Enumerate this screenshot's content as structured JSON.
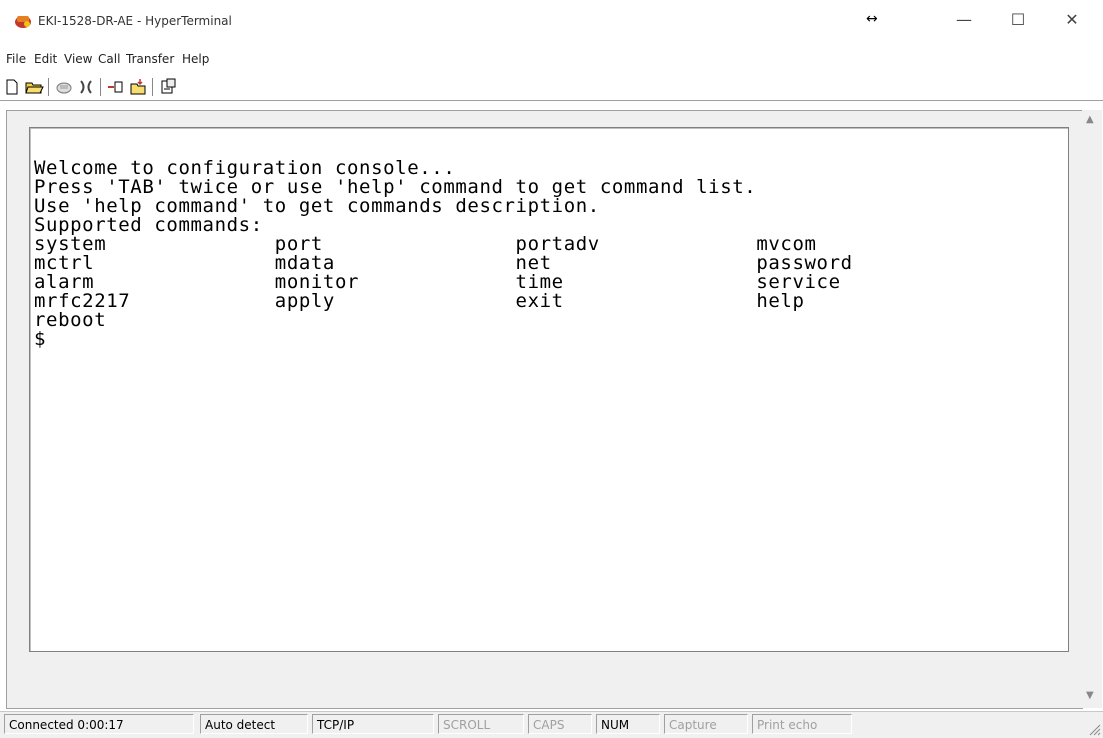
{
  "window": {
    "title": "EKI-1528-DR-AE - HyperTerminal",
    "resize_indicator": "↔",
    "controls": {
      "minimize": "—",
      "maximize": "☐",
      "close": "✕"
    }
  },
  "menu": [
    {
      "label": "File"
    },
    {
      "label": "Edit"
    },
    {
      "label": "View"
    },
    {
      "label": "Call"
    },
    {
      "label": "Transfer"
    },
    {
      "label": "Help"
    }
  ],
  "toolbar": {
    "icons": [
      "new-icon",
      "open-icon",
      "disconnect-icon",
      "dial-icon",
      "send-icon",
      "receive-icon",
      "properties-icon"
    ]
  },
  "terminal": {
    "lines": [
      "Welcome to configuration console...",
      "Press 'TAB' twice or use 'help' command to get command list.",
      "Use 'help command' to get commands description.",
      "Supported commands:",
      "system              port                portadv             mvcom",
      "mctrl               mdata               net                 password",
      "alarm               monitor             time                service",
      "mrfc2217            apply               exit                help",
      "reboot",
      "$"
    ]
  },
  "status": {
    "connected": "Connected 0:00:17",
    "detect": "Auto detect",
    "protocol": "TCP/IP",
    "scroll": "SCROLL",
    "caps": "CAPS",
    "num": "NUM",
    "capture": "Capture",
    "print_echo": "Print echo"
  },
  "colors": {
    "accent": "#c0392b",
    "inactive_text": "#a0a0a0"
  }
}
